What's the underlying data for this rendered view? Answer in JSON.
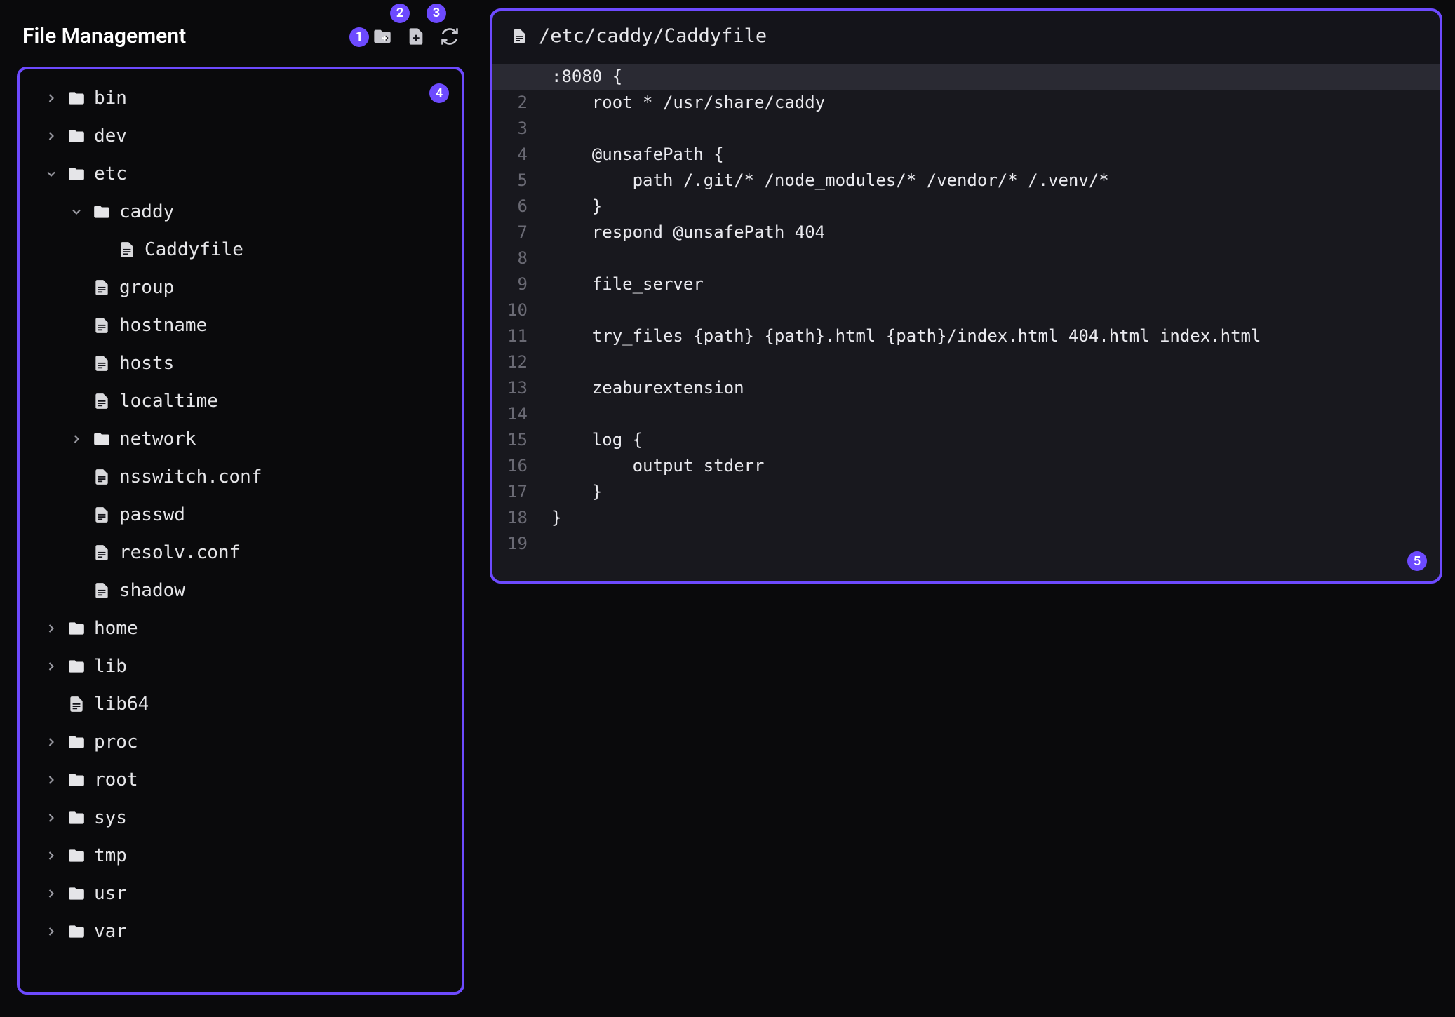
{
  "sidebar": {
    "title": "File Management",
    "actions": {
      "new_folder": "new-folder",
      "new_file": "new-file",
      "refresh": "refresh"
    }
  },
  "annotations": {
    "a1": "1",
    "a2": "2",
    "a3": "3",
    "a4": "4",
    "a5": "5"
  },
  "tree": [
    {
      "name": "bin",
      "type": "dir",
      "depth": 0,
      "expandable": true,
      "expanded": false
    },
    {
      "name": "dev",
      "type": "dir",
      "depth": 0,
      "expandable": true,
      "expanded": false
    },
    {
      "name": "etc",
      "type": "dir",
      "depth": 0,
      "expandable": true,
      "expanded": true
    },
    {
      "name": "caddy",
      "type": "dir",
      "depth": 1,
      "expandable": true,
      "expanded": true
    },
    {
      "name": "Caddyfile",
      "type": "file",
      "depth": 2,
      "expandable": false,
      "expanded": false
    },
    {
      "name": "group",
      "type": "file",
      "depth": 1,
      "expandable": false,
      "expanded": false
    },
    {
      "name": "hostname",
      "type": "file",
      "depth": 1,
      "expandable": false,
      "expanded": false
    },
    {
      "name": "hosts",
      "type": "file",
      "depth": 1,
      "expandable": false,
      "expanded": false
    },
    {
      "name": "localtime",
      "type": "file",
      "depth": 1,
      "expandable": false,
      "expanded": false
    },
    {
      "name": "network",
      "type": "dir",
      "depth": 1,
      "expandable": true,
      "expanded": false
    },
    {
      "name": "nsswitch.conf",
      "type": "file",
      "depth": 1,
      "expandable": false,
      "expanded": false
    },
    {
      "name": "passwd",
      "type": "file",
      "depth": 1,
      "expandable": false,
      "expanded": false
    },
    {
      "name": "resolv.conf",
      "type": "file",
      "depth": 1,
      "expandable": false,
      "expanded": false
    },
    {
      "name": "shadow",
      "type": "file",
      "depth": 1,
      "expandable": false,
      "expanded": false
    },
    {
      "name": "home",
      "type": "dir",
      "depth": 0,
      "expandable": true,
      "expanded": false
    },
    {
      "name": "lib",
      "type": "dir",
      "depth": 0,
      "expandable": true,
      "expanded": false
    },
    {
      "name": "lib64",
      "type": "file",
      "depth": 0,
      "expandable": false,
      "expanded": false
    },
    {
      "name": "proc",
      "type": "dir",
      "depth": 0,
      "expandable": true,
      "expanded": false
    },
    {
      "name": "root",
      "type": "dir",
      "depth": 0,
      "expandable": true,
      "expanded": false
    },
    {
      "name": "sys",
      "type": "dir",
      "depth": 0,
      "expandable": true,
      "expanded": false
    },
    {
      "name": "tmp",
      "type": "dir",
      "depth": 0,
      "expandable": true,
      "expanded": false
    },
    {
      "name": "usr",
      "type": "dir",
      "depth": 0,
      "expandable": true,
      "expanded": false
    },
    {
      "name": "var",
      "type": "dir",
      "depth": 0,
      "expandable": true,
      "expanded": false
    }
  ],
  "editor": {
    "path": "/etc/caddy/Caddyfile",
    "highlighted_line": 1,
    "lines": [
      ":8080 {",
      "    root * /usr/share/caddy",
      "",
      "    @unsafePath {",
      "        path /.git/* /node_modules/* /vendor/* /.venv/*",
      "    }",
      "    respond @unsafePath 404",
      "",
      "    file_server",
      "",
      "    try_files {path} {path}.html {path}/index.html 404.html index.html",
      "",
      "    zeaburextension",
      "",
      "    log {",
      "        output stderr",
      "    }",
      "}",
      ""
    ]
  },
  "colors": {
    "accent": "#6d4aff",
    "bg": "#0a0a0c",
    "panel": "#14141a",
    "code_bg": "#18181e"
  }
}
